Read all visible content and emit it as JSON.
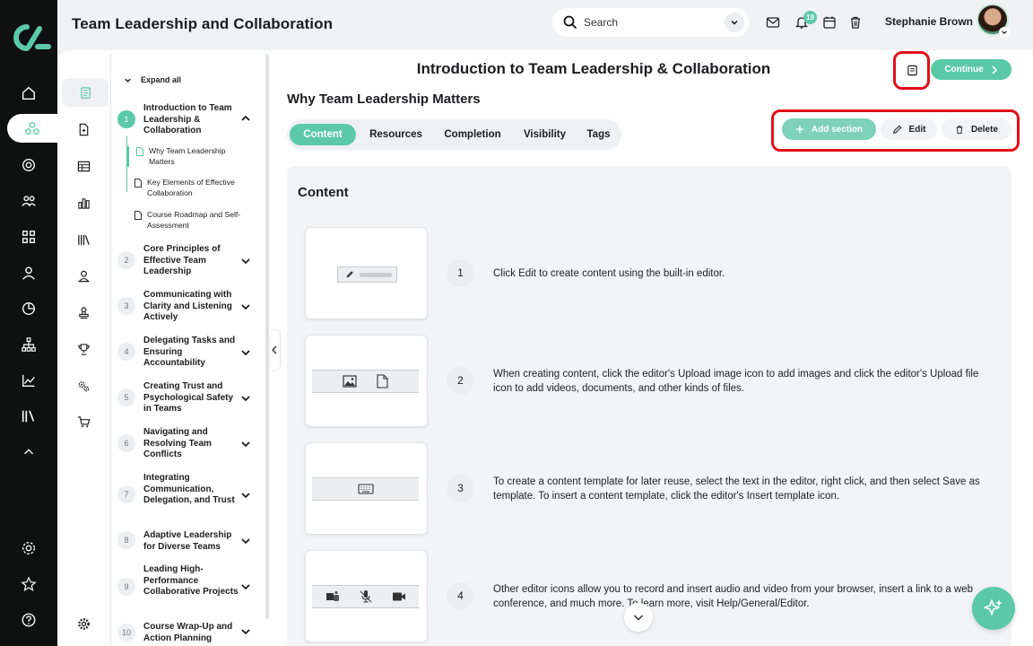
{
  "header": {
    "app_title": "Team Leadership and Collaboration",
    "search_placeholder": "Search",
    "notification_count": "19",
    "user_name": "Stephanie Brown"
  },
  "outline": {
    "expand_all": "Expand all",
    "modules": [
      {
        "num": "1",
        "title": "Introduction to Team Leadership & Collaboration",
        "expanded": true,
        "items": [
          "Why Team Leadership Matters",
          "Key Elements of Effective Collaboration",
          "Course Roadmap and Self-Assessment"
        ]
      },
      {
        "num": "2",
        "title": "Core Principles of Effective Team Leadership"
      },
      {
        "num": "3",
        "title": "Communicating with Clarity and Listening Actively"
      },
      {
        "num": "4",
        "title": "Delegating Tasks and Ensuring Accountability"
      },
      {
        "num": "5",
        "title": "Creating Trust and Psychological Safety in Teams"
      },
      {
        "num": "6",
        "title": "Navigating and Resolving Team Conflicts"
      },
      {
        "num": "7",
        "title": "Integrating Communication, Delegation, and Trust"
      },
      {
        "num": "8",
        "title": "Adaptive Leadership for Diverse Teams"
      },
      {
        "num": "9",
        "title": "Leading High-Performance Collaborative Projects"
      },
      {
        "num": "10",
        "title": "Course Wrap-Up and Action Planning"
      }
    ]
  },
  "main": {
    "page_title": "Introduction to Team Leadership & Collaboration",
    "continue_label": "Continue",
    "section_title": "Why Team Leadership Matters",
    "tabs": [
      "Content",
      "Resources",
      "Completion",
      "Visibility",
      "Tags"
    ],
    "active_tab": "Content",
    "actions": {
      "add_section": "Add section",
      "edit": "Edit",
      "delete": "Delete"
    },
    "content_heading": "Content",
    "steps": [
      {
        "num": "1",
        "text": "Click Edit to create content using the built-in editor."
      },
      {
        "num": "2",
        "text": "When creating content, click the editor's Upload image icon to add images and click the editor's Upload file icon to add videos, documents, and other kinds of files."
      },
      {
        "num": "3",
        "text": "To create a content template for later reuse, select the text in the editor, right click, and then select Save as template. To insert a content template, click the editor's Insert template icon."
      },
      {
        "num": "4",
        "text": "Other editor icons allow you to record and insert audio and video from your browser, insert a link to a web conference, and much more. To learn more, visit Help/General/Editor."
      }
    ]
  },
  "colors": {
    "accent": "#5bc9a6",
    "highlight": "#e0101a",
    "rail": "#0f1010"
  }
}
